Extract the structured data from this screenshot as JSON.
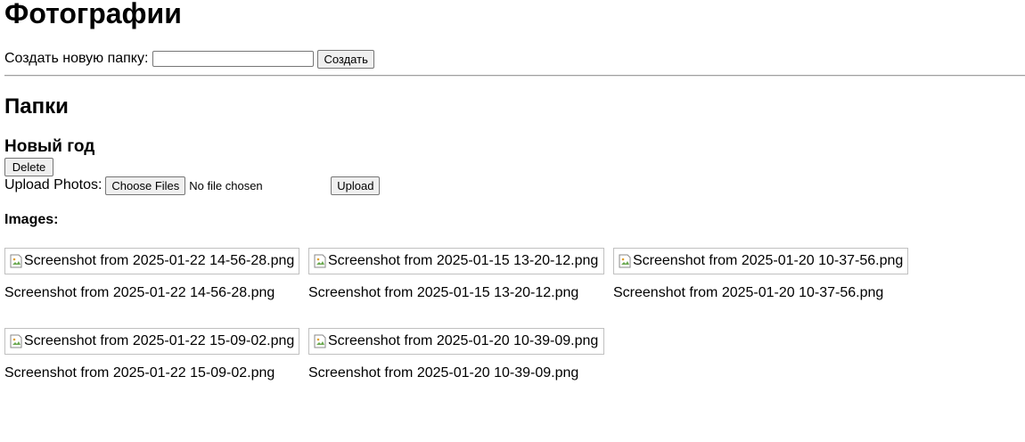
{
  "page": {
    "title": "Фотографии"
  },
  "create_folder": {
    "label": "Создать новую папку:",
    "input_value": "",
    "button_label": "Создать"
  },
  "folders": {
    "heading": "Папки",
    "items": [
      {
        "name": "Новый год",
        "delete_label": "Delete",
        "upload_label": "Upload Photos:",
        "choose_files_label": "Choose Files",
        "file_status": "No file chosen",
        "upload_button_label": "Upload",
        "images_label": "Images:",
        "images": [
          {
            "alt": "Screenshot from 2025-01-22 14-56-28.png",
            "caption": "Screenshot from 2025-01-22 14-56-28.png"
          },
          {
            "alt": "Screenshot from 2025-01-15 13-20-12.png",
            "caption": "Screenshot from 2025-01-15 13-20-12.png"
          },
          {
            "alt": "Screenshot from 2025-01-20 10-37-56.png",
            "caption": "Screenshot from 2025-01-20 10-37-56.png"
          },
          {
            "alt": "Screenshot from 2025-01-22 15-09-02.png",
            "caption": "Screenshot from 2025-01-22 15-09-02.png"
          },
          {
            "alt": "Screenshot from 2025-01-20 10-39-09.png",
            "caption": "Screenshot from 2025-01-20 10-39-09.png"
          }
        ]
      }
    ]
  },
  "icons": {
    "broken_image": "broken-image-icon"
  },
  "colors": {
    "divider": "#a0a0a0",
    "image_border": "#c0c0c0",
    "button_bg": "#efefef"
  }
}
